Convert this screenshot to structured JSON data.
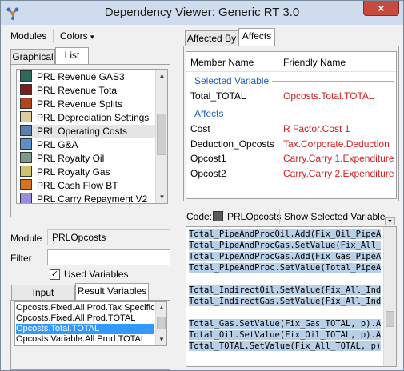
{
  "window": {
    "title": "Dependency Viewer: Generic RT 3.0",
    "close": "×"
  },
  "menu": {
    "modules": "Modules",
    "colors": "Colors",
    "colors_arrow": "▾"
  },
  "left_tabs": [
    "Graphical",
    "List"
  ],
  "module_list": [
    {
      "label": "PRL Revenue GAS3",
      "color": "#2b6b5b"
    },
    {
      "label": "PRL Revenue Total",
      "color": "#7a1f1f"
    },
    {
      "label": "PRL Revenue Splits",
      "color": "#b0461a"
    },
    {
      "label": "PRL Depreciation Settings",
      "color": "#d8cf9c"
    },
    {
      "label": "PRL Operating Costs",
      "color": "#5a7fb0"
    },
    {
      "label": "PRL G&A",
      "color": "#5b8fc8"
    },
    {
      "label": "PRL Royalty Oil",
      "color": "#7a9a8a"
    },
    {
      "label": "PRL Royalty Gas",
      "color": "#d0c46a"
    },
    {
      "label": "PRL Cash Flow BT",
      "color": "#d8701c"
    },
    {
      "label": "PRL Carry Repayment V2",
      "color": "#9a8ae0"
    }
  ],
  "module": {
    "label": "Module",
    "value": "PRLOpcosts"
  },
  "filter": {
    "label": "Filter",
    "value": ""
  },
  "used_variables": {
    "label": "Used Variables",
    "checked": "✓"
  },
  "var_tabs": [
    "Input Variables",
    "Result Variables"
  ],
  "result_vars": [
    "Opcosts.Fixed.All Prod.Tax Specific",
    "Opcosts.Fixed.All Prod.TOTAL",
    "Opcosts.Total.TOTAL",
    "Opcosts.Variable.All Prod.TOTAL"
  ],
  "right_tabs": [
    "Affected By",
    "Affects"
  ],
  "grid": {
    "col_member": "Member Name",
    "col_friendly": "Friendly Name",
    "selected_header": "Selected Variable",
    "selected": {
      "member": "Total_TOTAL",
      "friendly": "Opcosts.Total.TOTAL"
    },
    "affects_header": "Affects",
    "rows": [
      {
        "member": "Cost",
        "friendly": "R Factor.Cost 1"
      },
      {
        "member": "Deduction_Opcosts",
        "friendly": "Tax.Corporate.Deduction"
      },
      {
        "member": "Opcost1",
        "friendly": "Carry.Carry 1.Expenditure"
      },
      {
        "member": "Opcost2",
        "friendly": "Carry.Carry 2.Expenditure"
      }
    ]
  },
  "code_bar": {
    "label": "Code:",
    "module": "PRLOpcosts",
    "button": "Show Selected Variable",
    "color": "#5a5a5a"
  },
  "code_lines": [
    "Total_PipeAndProcOil.Add(Fix_Oil_PipeAnd",
    "Total_PipeAndProcGas.SetValue(Fix_All_Pi",
    "Total_PipeAndProcGas.Add(Fix_Gas_PipeAnd",
    "Total_PipeAndProc.SetValue(Total_PipeAnd",
    "",
    "Total_IndirectOil.SetValue(Fix_All_Indir",
    "Total_IndirectGas.SetValue(Fix_All_Indir",
    "",
    "Total_Gas.SetValue(Fix_Gas_TOTAL, p).Add",
    "Total_Oil.SetValue(Fix_Oil_TOTAL, p).Add",
    "Total_TOTAL.SetValue(Fix_All_TOTAL, p).A"
  ]
}
